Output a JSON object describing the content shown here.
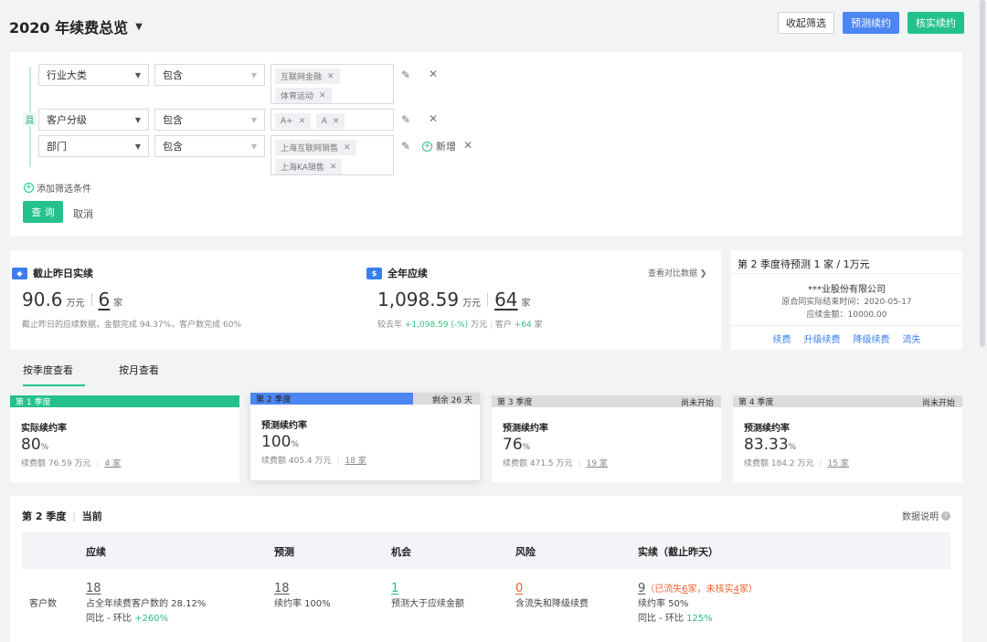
{
  "header": {
    "title": "2020 年续费总览",
    "btn_collapse": "收起筛选",
    "btn_forecast": "预测续约",
    "btn_verify": "核实续约"
  },
  "filters": {
    "and_label": "且",
    "rows": [
      {
        "field": "行业大类",
        "op": "包含",
        "tags": [
          "互联网金融",
          "体育运动"
        ]
      },
      {
        "field": "客户分级",
        "op": "包含",
        "tags": [
          "A+",
          "A"
        ]
      },
      {
        "field": "部门",
        "op": "包含",
        "tags": [
          "上海互联网销售",
          "上海KA销售"
        ]
      }
    ],
    "add_new": "新增",
    "add_condition": "添加筛选条件",
    "query": "查 询",
    "cancel": "取消"
  },
  "stats": {
    "yesterday": {
      "title": "截止昨日实续",
      "amount": "90.6",
      "amount_unit": "万元",
      "count": "6",
      "count_unit": "家",
      "note": "截止昨日的应续数据，金额完成 94.37%，客户数完成 60%"
    },
    "annual": {
      "title": "全年应续",
      "amount": "1,098.59",
      "amount_unit": "万元",
      "count": "64",
      "count_unit": "家",
      "note_prefix": "较去年",
      "note_amount": "+1,098.59 (-%)",
      "note_amount_unit": "万元",
      "note_customer": "客户",
      "note_customer_val": "+64",
      "note_customer_unit": "家"
    },
    "compare_link": "查看对比数据"
  },
  "side": {
    "title": "第 2 季度待预测 1 家 / 1万元",
    "company": "***业股份有限公司",
    "end_time": "原合同实际结束时间：2020-05-17",
    "amount": "应续金额：10000.00",
    "links": [
      "续费",
      "升级续费",
      "降级续费",
      "流失"
    ]
  },
  "tabs": [
    "按季度查看",
    "按月查看"
  ],
  "quarters": [
    {
      "bar": "第 1 季度",
      "right": "",
      "label": "实际续约率",
      "value": "80",
      "pct": "%",
      "amount": "续费额 76.59 万元",
      "count": "4 家",
      "color": "#24c28a"
    },
    {
      "bar": "第 2 季度",
      "right": "剩余 26 天",
      "label": "预测续约率",
      "value": "100",
      "pct": "%",
      "amount": "续费额 405.4 万元",
      "count": "18 家",
      "color": "#4c86f2"
    },
    {
      "bar": "第 3 季度",
      "right": "尚未开始",
      "label": "预测续约率",
      "value": "76",
      "pct": "%",
      "amount": "续费额 471.5 万元",
      "count": "19 家",
      "color": "#dcdcdc"
    },
    {
      "bar": "第 4 季度",
      "right": "尚未开始",
      "label": "预测续约率",
      "value": "83.33",
      "pct": "%",
      "amount": "续费额 184.2 万元",
      "count": "15 家",
      "color": "#dcdcdc"
    }
  ],
  "q2_progress": 0.71,
  "bottom": {
    "title": "第 2 季度",
    "current": "当前",
    "help": "数据说明",
    "headers": [
      "应续",
      "预测",
      "机会",
      "风险",
      "实续（截止昨天）"
    ],
    "row_label": "客户数",
    "c1": {
      "n": "18",
      "l1": "占全年续费客户数的 28.12%",
      "l2a": "同比 - 环比",
      "l2b": "+260%"
    },
    "c2": {
      "n": "18",
      "l1": "续约率 100%"
    },
    "c3": {
      "n": "1",
      "l1": "预测大于应续金额"
    },
    "c4": {
      "n": "0",
      "l1": "含流失和降级续费"
    },
    "c5": {
      "n": "9",
      "extra_a": "（已流失",
      "extra_b": "6",
      "extra_c": "家，未核实",
      "extra_d": "4",
      "extra_e": "家）",
      "l1": "续约率 50%",
      "l2a": "同比 - 环比",
      "l2b": "125%"
    }
  }
}
